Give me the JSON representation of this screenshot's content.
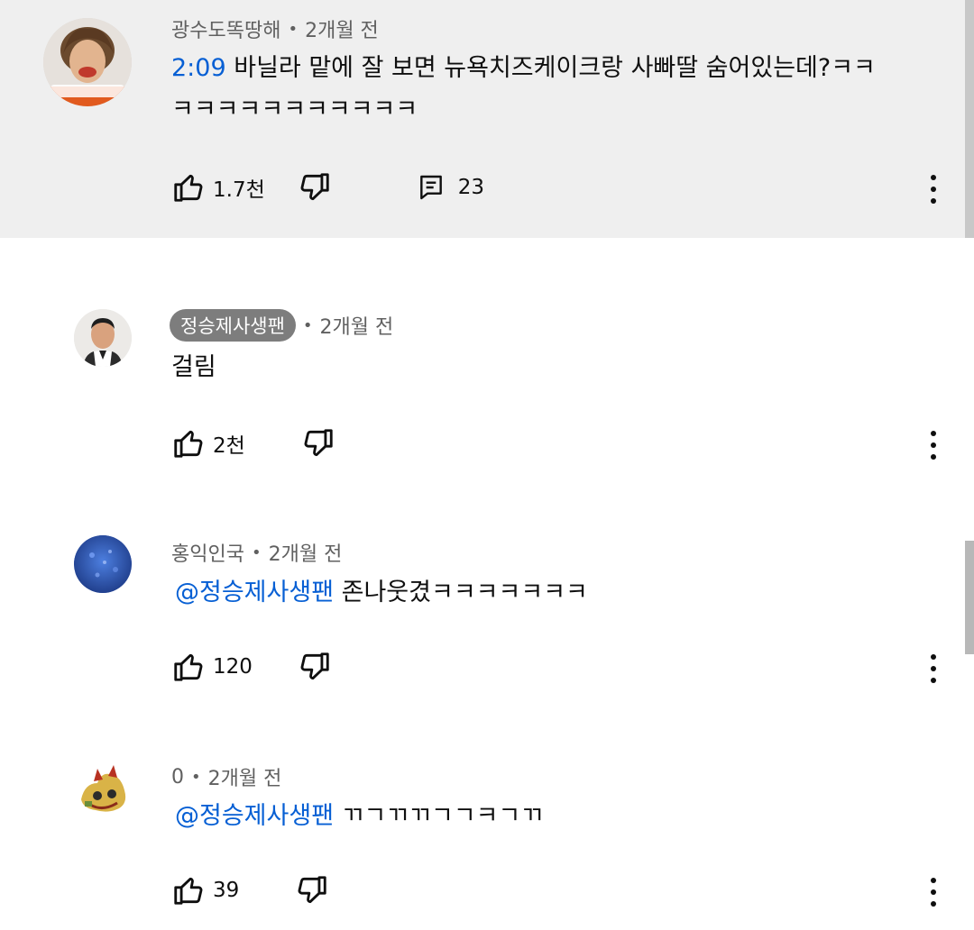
{
  "comments": [
    {
      "author": "광수도똑땅해",
      "time": "2개월 전",
      "timestamp_link": "2:09",
      "text_line1": " 바닐라 맡에 잘 보면 뉴욕치즈케이크랑 사빠딸 숨어있는데?ㅋㅋ",
      "text_line2": "ㅋㅋㅋㅋㅋㅋㅋㅋㅋㅋㅋ",
      "likes": "1.7천",
      "replies": "23"
    },
    {
      "author": "정승제사생팬",
      "time": "2개월 전",
      "text": "걸림",
      "likes": "2천"
    },
    {
      "author": "홍익인국",
      "time": "2개월 전",
      "mention": "@정승제사생팬",
      "text": " 존나웃겼ㅋㅋㅋㅋㅋㅋㅋ",
      "likes": "120"
    },
    {
      "author": "0",
      "time": "2개월 전",
      "mention": "@정승제사생팬",
      "text": " ㄲㄱㄲㄲㄱㄱㅋㄱㄲ",
      "likes": "39"
    }
  ],
  "icons": {
    "like": "thumbs-up-icon",
    "dislike": "thumbs-down-icon",
    "reply": "reply-comment-icon",
    "more": "more-vertical-icon"
  },
  "colors": {
    "link": "#065fd4",
    "highlight_bg": "#efefef",
    "meta": "#606060",
    "chip_bg": "#7d7d7d"
  }
}
